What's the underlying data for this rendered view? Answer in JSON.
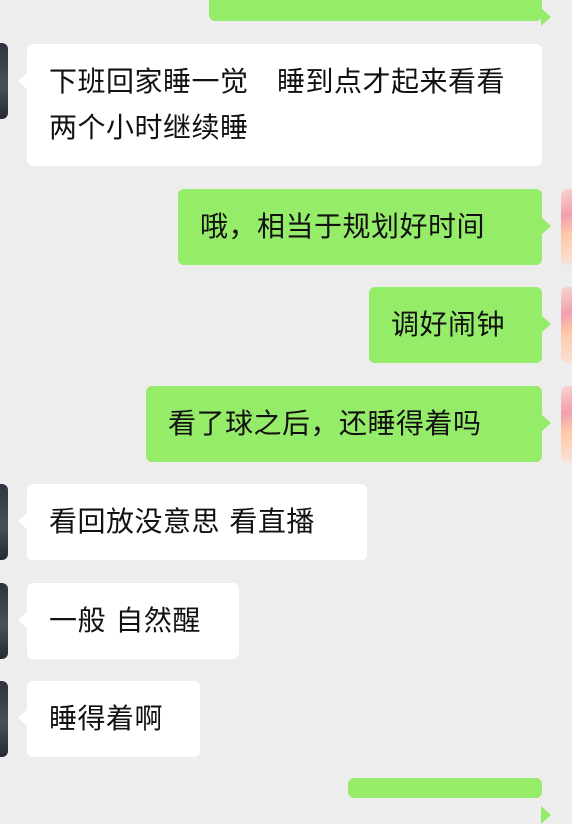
{
  "messages": [
    {
      "side": "right",
      "text": ""
    },
    {
      "side": "left",
      "text": "下班回家睡一觉　睡到点才起来看看两个小时继续睡"
    },
    {
      "side": "right",
      "text": "哦，相当于规划好时间"
    },
    {
      "side": "right",
      "text": "调好闹钟"
    },
    {
      "side": "right",
      "text": "看了球之后，还睡得着吗"
    },
    {
      "side": "left",
      "text": "看回放没意思 看直播"
    },
    {
      "side": "left",
      "text": "一般 自然醒"
    },
    {
      "side": "left",
      "text": "睡得着啊"
    }
  ],
  "colors": {
    "background": "#ededed",
    "incoming_bubble": "#ffffff",
    "outgoing_bubble": "#95ec69"
  }
}
